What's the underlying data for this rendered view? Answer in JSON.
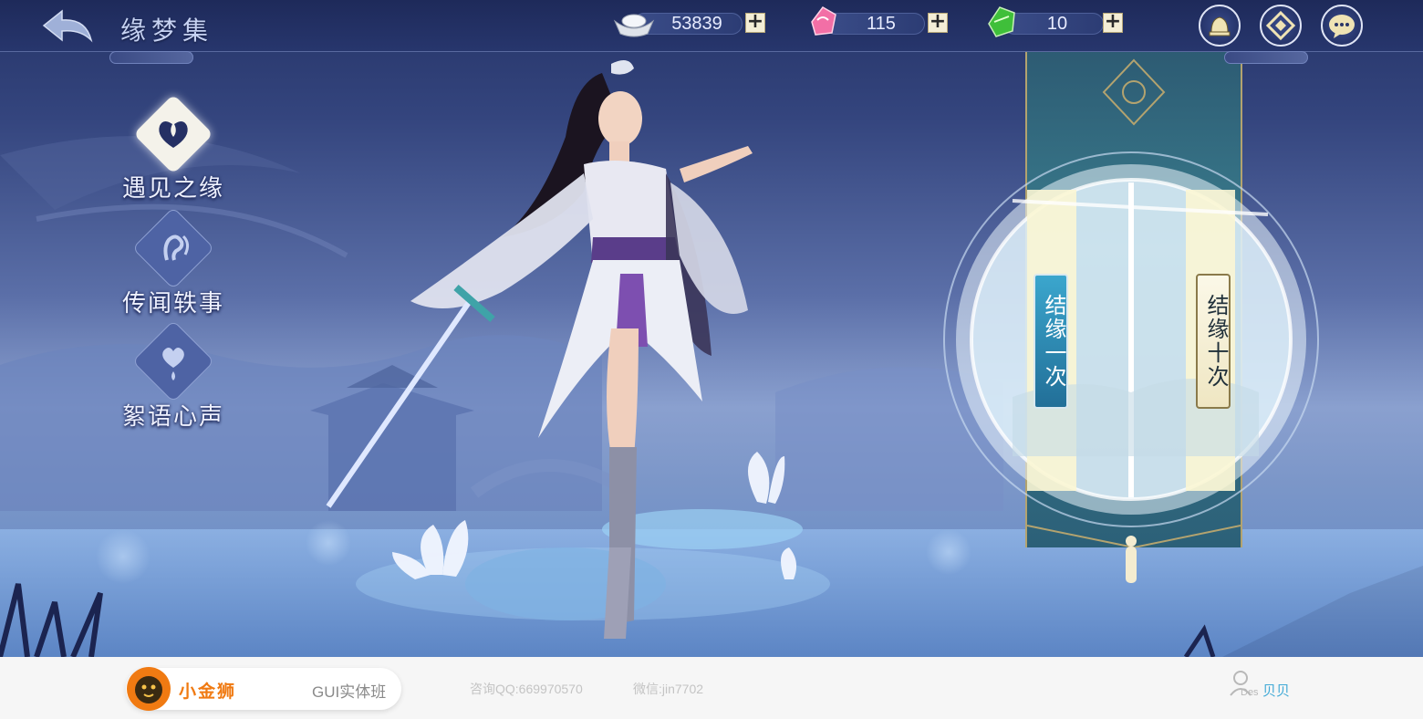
{
  "header": {
    "title": "缘梦集",
    "currencies": [
      {
        "name": "silver",
        "icon": "silver-ingot-icon",
        "value": "53839"
      },
      {
        "name": "pink-gem",
        "icon": "pink-gem-icon",
        "value": "115"
      },
      {
        "name": "green-gem",
        "icon": "green-gem-icon",
        "value": "10"
      }
    ]
  },
  "left_menu": [
    {
      "label": "遇见之缘",
      "icon": "swan-heart-icon",
      "active": true
    },
    {
      "label": "传闻轶事",
      "icon": "ear-sound-icon",
      "active": false
    },
    {
      "label": "絮语心声",
      "icon": "heart-drop-icon",
      "active": false
    }
  ],
  "summon": {
    "once_label": "结缘一次",
    "ten_label": "结缘十次"
  },
  "footer": {
    "brand_name": "小金狮",
    "course": "GUI实体班",
    "qq": "咨询QQ:669970570",
    "wechat": "微信:jin7702",
    "author_tag": "Des",
    "author_name": "贝贝"
  },
  "colors": {
    "accent_gold": "#b3a36f",
    "brand_orange": "#f07a12",
    "summon_once": "#2f8fb5",
    "summon_ten": "#f2ecd0"
  }
}
